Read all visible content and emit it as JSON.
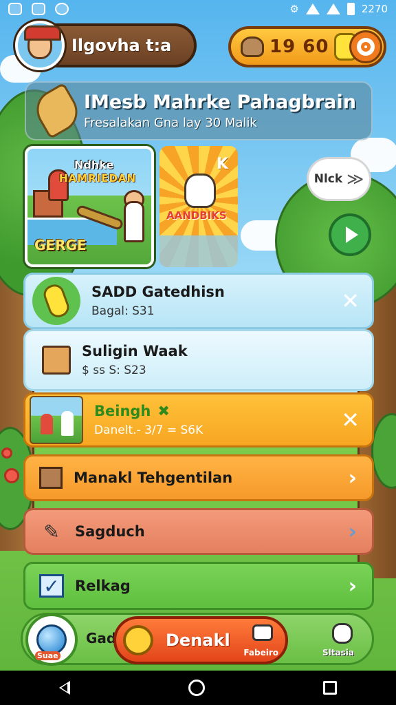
{
  "status_bar": {
    "time": "2270",
    "left_icons": [
      "app-icon",
      "notification-icon",
      "sync-icon"
    ],
    "right_icons": [
      "settings-icon",
      "wifi-icon",
      "signal-icon",
      "battery-icon"
    ]
  },
  "profile": {
    "name": "Ilgovha t:a",
    "avatar_icon": "character-avatar-icon"
  },
  "currency": {
    "value": "19 60",
    "left_icon": "coin-sack-icon",
    "right_icon": "gem-icon",
    "settings_icon": "gear-icon"
  },
  "quest": {
    "title": "IMesb Mahrke Pahagbrain",
    "subtitle": "Fresalakan Gna lay 30 Malik",
    "icon": "leaf-icon"
  },
  "cards": {
    "main": {
      "title": "Ndhke",
      "subtitle": "HAMRIEDAN",
      "tag": "GERGE"
    },
    "second": {
      "corner": "K",
      "label": "AANDBIKS"
    },
    "next_label": "Nlck",
    "next_arrow": "≫"
  },
  "list": {
    "items": [
      {
        "title": "SADD Gatedhisn",
        "subtitle": "Bagal: S31",
        "icon": "popsicle-icon",
        "action": "close"
      },
      {
        "title": "Suligin Waak",
        "subtitle": "$ ss S: S23",
        "icon": "notebook-icon",
        "action": "none"
      },
      {
        "title": "Beingh",
        "subtitle": "Danelt.- 3/7 = S6K",
        "icon": "scene-thumbnail-icon",
        "check": "✖",
        "action": "close"
      },
      {
        "title": "Manakl Tehgentilan",
        "icon": "box-icon",
        "action": "chevron"
      },
      {
        "title": "Sagduch",
        "icon": "pencil-icon",
        "action": "chevron"
      },
      {
        "title": "Relkag",
        "icon": "checkbox-icon",
        "action": "chevron"
      }
    ],
    "close_glyph": "✕",
    "chevron_glyph": "›"
  },
  "bottom_bar": {
    "left_label": "Gad",
    "globe_badge": "Suae",
    "main_button": "Denakl",
    "camera_label": "Fabeiro",
    "right_label": "Sltasia"
  }
}
